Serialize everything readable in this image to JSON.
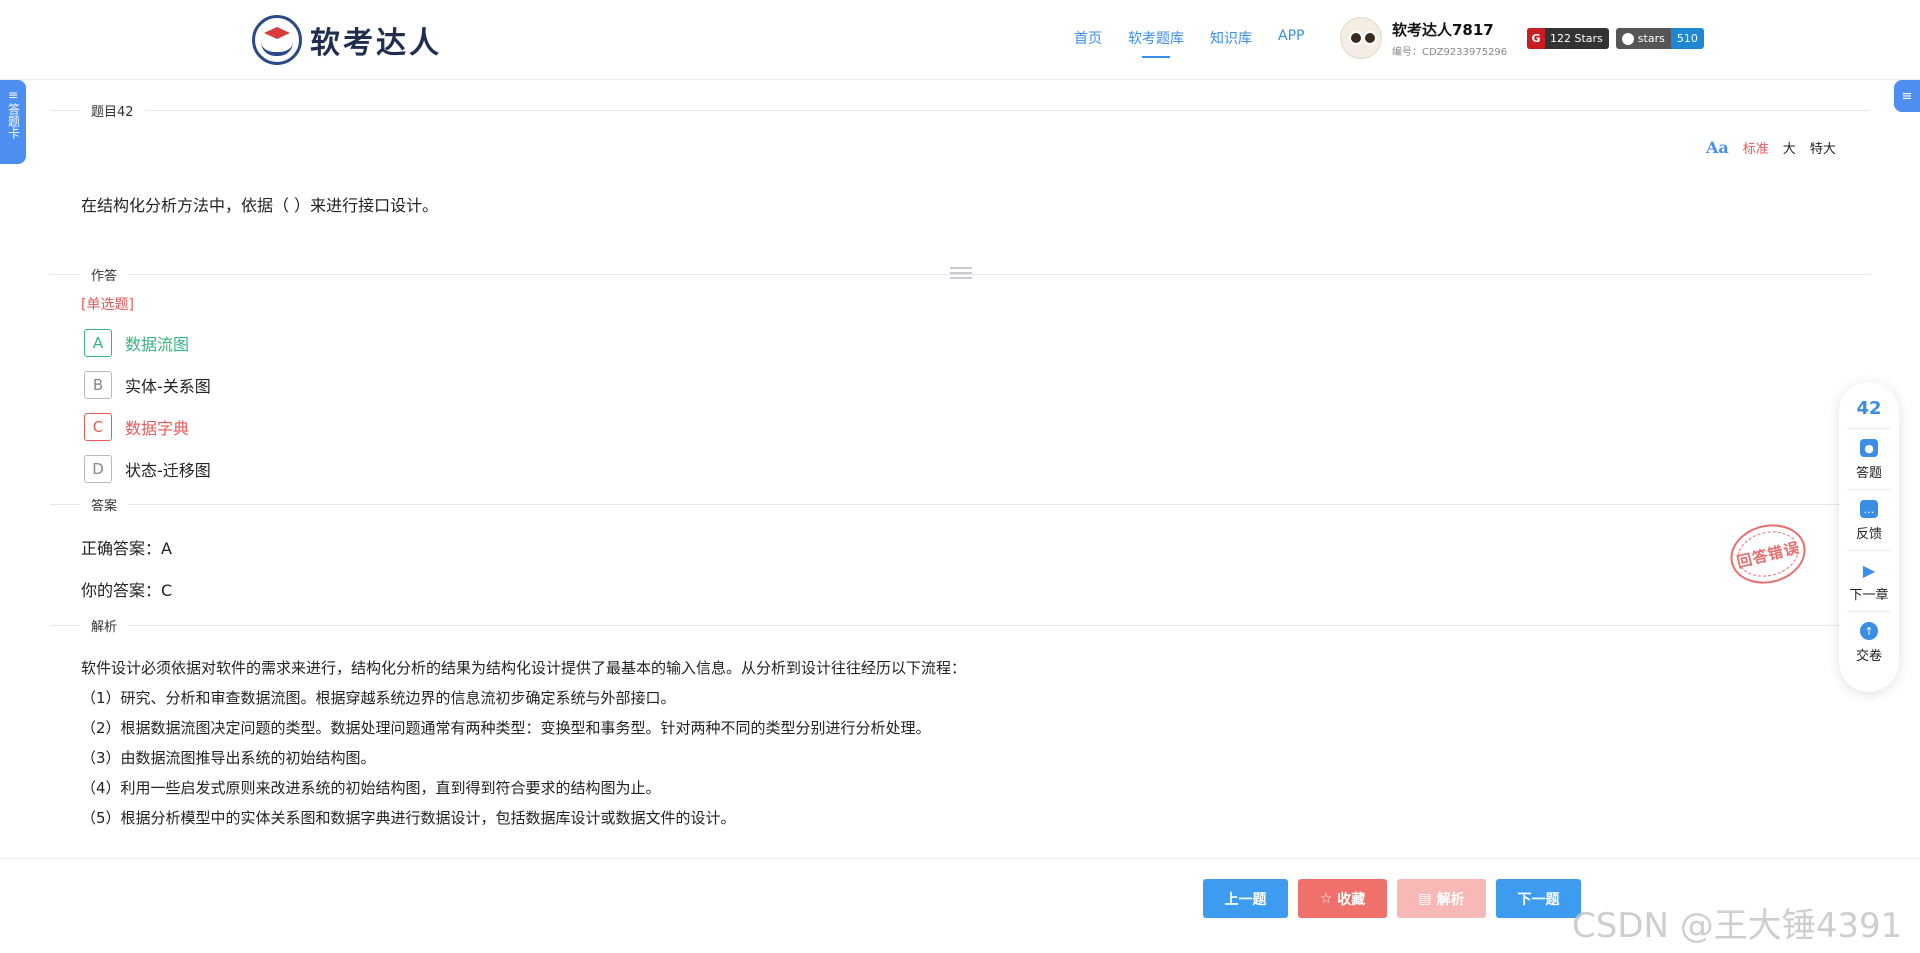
{
  "header": {
    "logo_text": "软考达人",
    "nav": [
      {
        "label": "首页",
        "active": false
      },
      {
        "label": "软考题库",
        "active": true
      },
      {
        "label": "知识库",
        "active": false
      },
      {
        "label": "APP",
        "active": false
      }
    ],
    "user": {
      "name": "软考达人7817",
      "id": "编号：CDZ9233975296"
    },
    "badges": {
      "gitee_count": "122 Stars",
      "github_label": "stars",
      "github_count": "510"
    }
  },
  "side_tabs": {
    "answer_card": "答题卡",
    "right_icon": "≡"
  },
  "question": {
    "section_label": "题目42",
    "font_size": {
      "standard": "标准",
      "large": "大",
      "xlarge": "特大",
      "icon": "Aa"
    },
    "text": "在结构化分析方法中，依据（ ）来进行接口设计。"
  },
  "answer_area": {
    "section_label": "作答",
    "type": "[单选题]",
    "options": [
      {
        "letter": "A",
        "text": "数据流图",
        "state": "correct"
      },
      {
        "letter": "B",
        "text": "实体-关系图",
        "state": "normal"
      },
      {
        "letter": "C",
        "text": "数据字典",
        "state": "wrong"
      },
      {
        "letter": "D",
        "text": "状态-迁移图",
        "state": "normal"
      }
    ]
  },
  "answer": {
    "section_label": "答案",
    "correct": "正确答案：A",
    "yours": "你的答案：C",
    "stamp": "回答错误"
  },
  "analysis": {
    "section_label": "解析",
    "lines": [
      "软件设计必须依据对软件的需求来进行，结构化分析的结果为结构化设计提供了最基本的输入信息。从分析到设计往往经历以下流程：",
      "（1）研究、分析和审查数据流图。根据穿越系统边界的信息流初步确定系统与外部接口。",
      "（2）根据数据流图决定问题的类型。数据处理问题通常有两种类型：变换型和事务型。针对两种不同的类型分别进行分析处理。",
      "（3）由数据流图推导出系统的初始结构图。",
      "（4）利用一些启发式原则来改进系统的初始结构图，直到得到符合要求的结构图为止。",
      "（5）根据分析模型中的实体关系图和数据字典进行数据设计，包括数据库设计或数据文件的设计。"
    ]
  },
  "float_bar": {
    "number": "42",
    "items": [
      "答题",
      "反馈",
      "下一章",
      "交卷"
    ]
  },
  "bottom": {
    "prev": "上一题",
    "favorite": "收藏",
    "analysis": "解析",
    "next": "下一题",
    "watermark": "CSDN @王大锤4391"
  },
  "colors": {
    "accent": "#3a8ee6",
    "correct": "#36b37e",
    "wrong": "#e85a5a"
  }
}
